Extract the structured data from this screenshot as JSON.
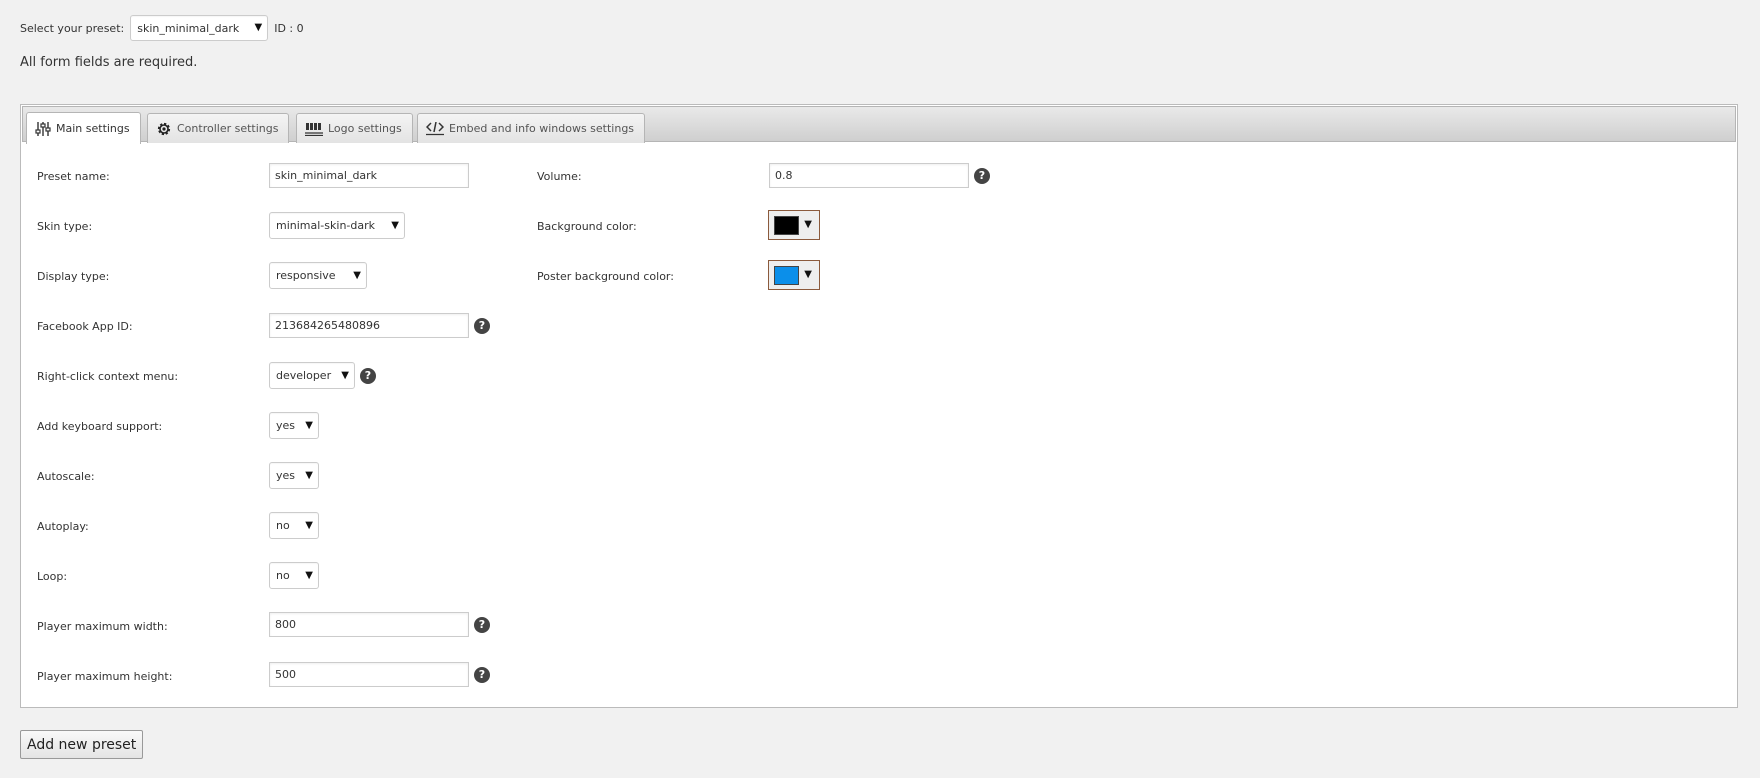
{
  "preset_bar": {
    "label": "Select your preset:",
    "selected": "skin_minimal_dark",
    "id_label": "ID : 0"
  },
  "required_note": "All form fields are required.",
  "tabs": [
    {
      "label": "Main settings",
      "icon": "sliders-icon",
      "active": true
    },
    {
      "label": "Controller settings",
      "icon": "gear-icon",
      "active": false
    },
    {
      "label": "Logo settings",
      "icon": "logo-icon",
      "active": false
    },
    {
      "label": "Embed and info windows settings",
      "icon": "embed-icon",
      "active": false
    }
  ],
  "left_fields": {
    "preset_name": {
      "label": "Preset name:",
      "value": "skin_minimal_dark"
    },
    "skin_type": {
      "label": "Skin type:",
      "value": "minimal-skin-dark"
    },
    "display_type": {
      "label": "Display type:",
      "value": "responsive"
    },
    "facebook_app_id": {
      "label": "Facebook App ID:",
      "value": "213684265480896"
    },
    "context_menu": {
      "label": "Right-click context menu:",
      "value": "developer"
    },
    "keyboard": {
      "label": "Add keyboard support:",
      "value": "yes"
    },
    "autoscale": {
      "label": "Autoscale:",
      "value": "yes"
    },
    "autoplay": {
      "label": "Autoplay:",
      "value": "no"
    },
    "loop": {
      "label": "Loop:",
      "value": "no"
    },
    "max_width": {
      "label": "Player maximum width:",
      "value": "800"
    },
    "max_height": {
      "label": "Player maximum height:",
      "value": "500"
    }
  },
  "right_fields": {
    "volume": {
      "label": "Volume:",
      "value": "0.8"
    },
    "background_color": {
      "label": "Background color:",
      "color": "#000000"
    },
    "poster_background_color": {
      "label": "Poster background color:",
      "color": "#0b8fea"
    }
  },
  "help_glyph": "?",
  "caret_glyph": "▼",
  "add_button": "Add new preset"
}
